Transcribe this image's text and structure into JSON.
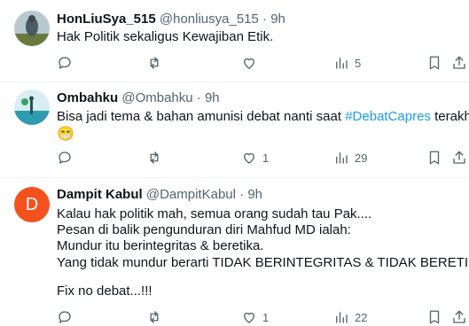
{
  "tweets": [
    {
      "name": "HonLiuSya_515",
      "handle": "@honliusya_515",
      "sep": "·",
      "time": "9h",
      "text": "Hak Politik sekaligus Kewajiban Etik.",
      "replies": "",
      "retweets": "",
      "likes": "",
      "views": "5"
    },
    {
      "name": "Ombahku",
      "handle": "@Ombahku",
      "sep": "·",
      "time": "9h",
      "text_before": "Bisa jadi tema & bahan amunisi debat nanti saat ",
      "hashtag": "#DebatCapres",
      "text_after": " terakhir",
      "emoji": "😁",
      "replies": "",
      "retweets": "",
      "likes": "1",
      "views": "29"
    },
    {
      "name": "Dampit Kabul",
      "handle": "@DampitKabul",
      "sep": "·",
      "time": "9h",
      "avatar_letter": "D",
      "lines": [
        "Kalau hak politik mah, semua orang sudah tau Pak....",
        "Pesan di balik pengunduran diri Mahfud MD ialah:",
        "Mundur itu berintegritas & beretika.",
        "Yang tidak mundur berarti TIDAK BERINTEGRITAS & TIDAK BERETIKA.",
        "",
        "Fix no debat...!!!"
      ],
      "replies": "",
      "retweets": "",
      "likes": "1",
      "views": "22"
    }
  ],
  "icons": [
    "reply-icon",
    "retweet-icon",
    "like-icon",
    "views-icon",
    "bookmark-icon",
    "share-icon"
  ],
  "colors": {
    "text": "#0f1419",
    "muted": "#536471",
    "link": "#1d9bf0",
    "divider": "#eff3f4",
    "avatar_d": "#f4511e"
  }
}
